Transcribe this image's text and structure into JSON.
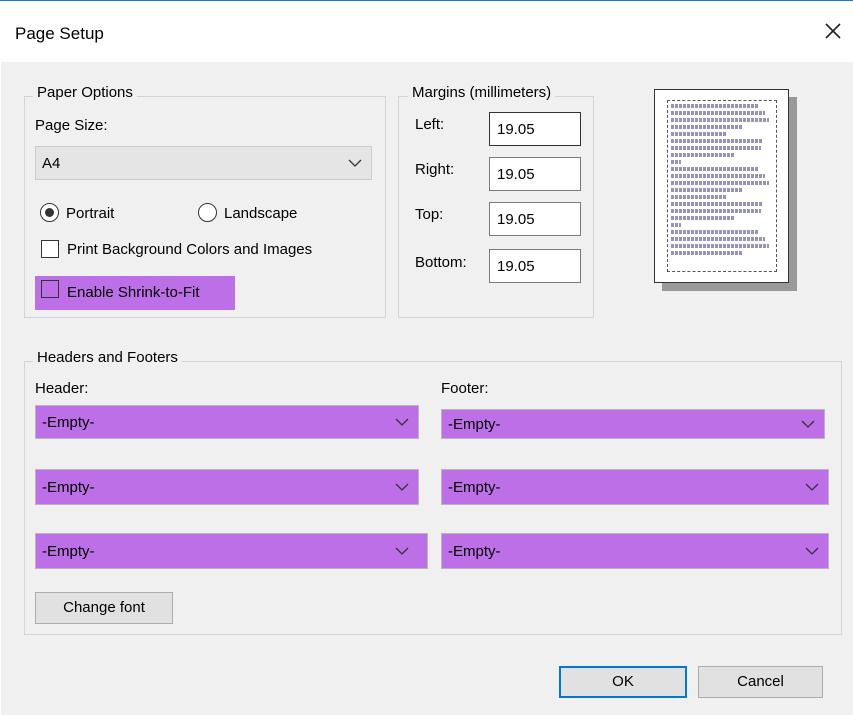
{
  "window": {
    "title": "Page Setup"
  },
  "paper_options": {
    "legend": "Paper Options",
    "page_size_label": "Page Size:",
    "page_size_value": "A4",
    "portrait_label": "Portrait",
    "landscape_label": "Landscape",
    "orientation": "Portrait",
    "print_background_label": "Print Background Colors and Images",
    "print_background_checked": false,
    "shrink_label": "Enable Shrink-to-Fit",
    "shrink_checked": false
  },
  "margins": {
    "legend": "Margins (millimeters)",
    "left_label": "Left:",
    "left_value": "19.05",
    "right_label": "Right:",
    "right_value": "19.05",
    "top_label": "Top:",
    "top_value": "19.05",
    "bottom_label": "Bottom:",
    "bottom_value": "19.05"
  },
  "headers_footers": {
    "legend": "Headers and Footers",
    "header_label": "Header:",
    "footer_label": "Footer:",
    "header": [
      "-Empty-",
      "-Empty-",
      "-Empty-"
    ],
    "footer": [
      "-Empty-",
      "-Empty-",
      "-Empty-"
    ],
    "change_font_label": "Change font"
  },
  "buttons": {
    "ok": "OK",
    "cancel": "Cancel"
  },
  "colors": {
    "highlight": "#bc6fe6",
    "dialog_bg": "#f0f0f0",
    "accent": "#0078d7"
  }
}
